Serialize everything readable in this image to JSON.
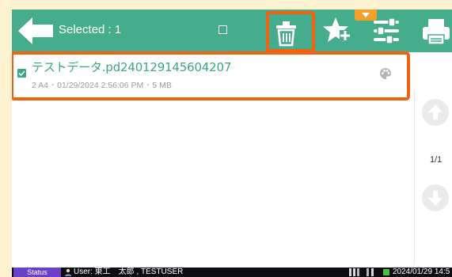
{
  "toolbar": {
    "selected_label": "Selected : 1",
    "background": "#45ad8c"
  },
  "icons": {
    "back": "back-arrow-icon",
    "select_all": "checkbox-empty-icon",
    "delete": "trash-icon",
    "favorite": "star-plus-icon",
    "settings": "sliders-icon",
    "print": "printer-icon",
    "dropdown": "dropdown-arrow-icon",
    "palette": "palette-icon",
    "scroll_up": "arrow-up-icon",
    "scroll_down": "arrow-down-icon",
    "user": "user-icon"
  },
  "file": {
    "name": "テストデータ.pd240129145604207",
    "meta": "2 A4 ･ 01/29/2024 2:56:06 PM ･ 5 MB",
    "selected": true
  },
  "pagination": {
    "label": "1/1"
  },
  "status_bar": {
    "tab_label": "Status",
    "user_label": "User: 東工　太郎 , TESTUSER",
    "datetime": "2024/01/29 14:5"
  },
  "colors": {
    "accent": "#45ad8c",
    "highlight": "#ee6413",
    "dropdown_tab": "#f4a028",
    "status_tab": "#6a41c8"
  }
}
